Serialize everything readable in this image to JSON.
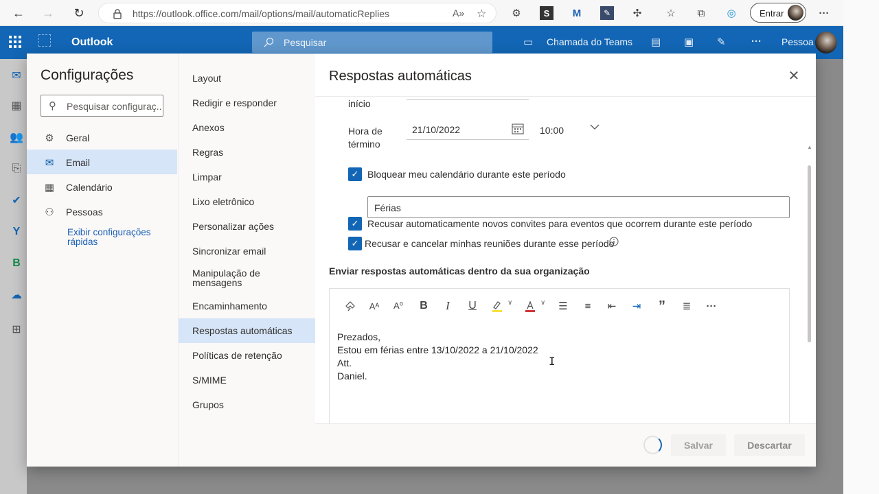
{
  "browser": {
    "url": "https://outlook.office.com/mail/options/mail/automaticReplies",
    "signin_label": "Entrar"
  },
  "header": {
    "app_name": "Outlook",
    "search_placeholder": "Pesquisar",
    "teams_label": "Chamada do Teams",
    "user_label": "Pessoa"
  },
  "settings": {
    "title": "Configurações",
    "search_placeholder": "Pesquisar configuraç...",
    "categories": [
      {
        "label": "Geral",
        "icon": "gear-icon"
      },
      {
        "label": "Email",
        "icon": "mail-icon"
      },
      {
        "label": "Calendário",
        "icon": "calendar-icon"
      },
      {
        "label": "Pessoas",
        "icon": "people-icon"
      }
    ],
    "quick_link": "Exibir configurações rápidas",
    "subitems": [
      "Layout",
      "Redigir e responder",
      "Anexos",
      "Regras",
      "Limpar",
      "Lixo eletrônico",
      "Personalizar ações",
      "Sincronizar email",
      "Manipulação de mensagens",
      "Encaminhamento",
      "Respostas automáticas",
      "Políticas de retenção",
      "S/MIME",
      "Grupos"
    ]
  },
  "panel": {
    "title": "Respostas automáticas",
    "start_label_partial": "início",
    "end_label": "Hora de término",
    "end_date": "21/10/2022",
    "end_time": "10:00",
    "block_calendar_label": "Bloquear meu calendário durante este período",
    "block_calendar_checked": true,
    "event_title": "Férias",
    "decline_invites_label": "Recusar automaticamente novos convites para eventos que ocorrem durante este período",
    "decline_invites_checked": true,
    "cancel_meetings_label": "Recusar e cancelar minhas reuniões durante esse período",
    "cancel_meetings_checked": true,
    "section_heading": "Enviar respostas automáticas dentro da sua organização",
    "message_lines": [
      "Prezados,",
      "Estou em férias entre 13/10/2022 a 21/10/2022",
      "Att.",
      "Daniel."
    ],
    "save_label": "Salvar",
    "discard_label": "Descartar"
  },
  "colors": {
    "brand_blue": "#1266b5",
    "selected_bg": "#d6e5f7"
  }
}
